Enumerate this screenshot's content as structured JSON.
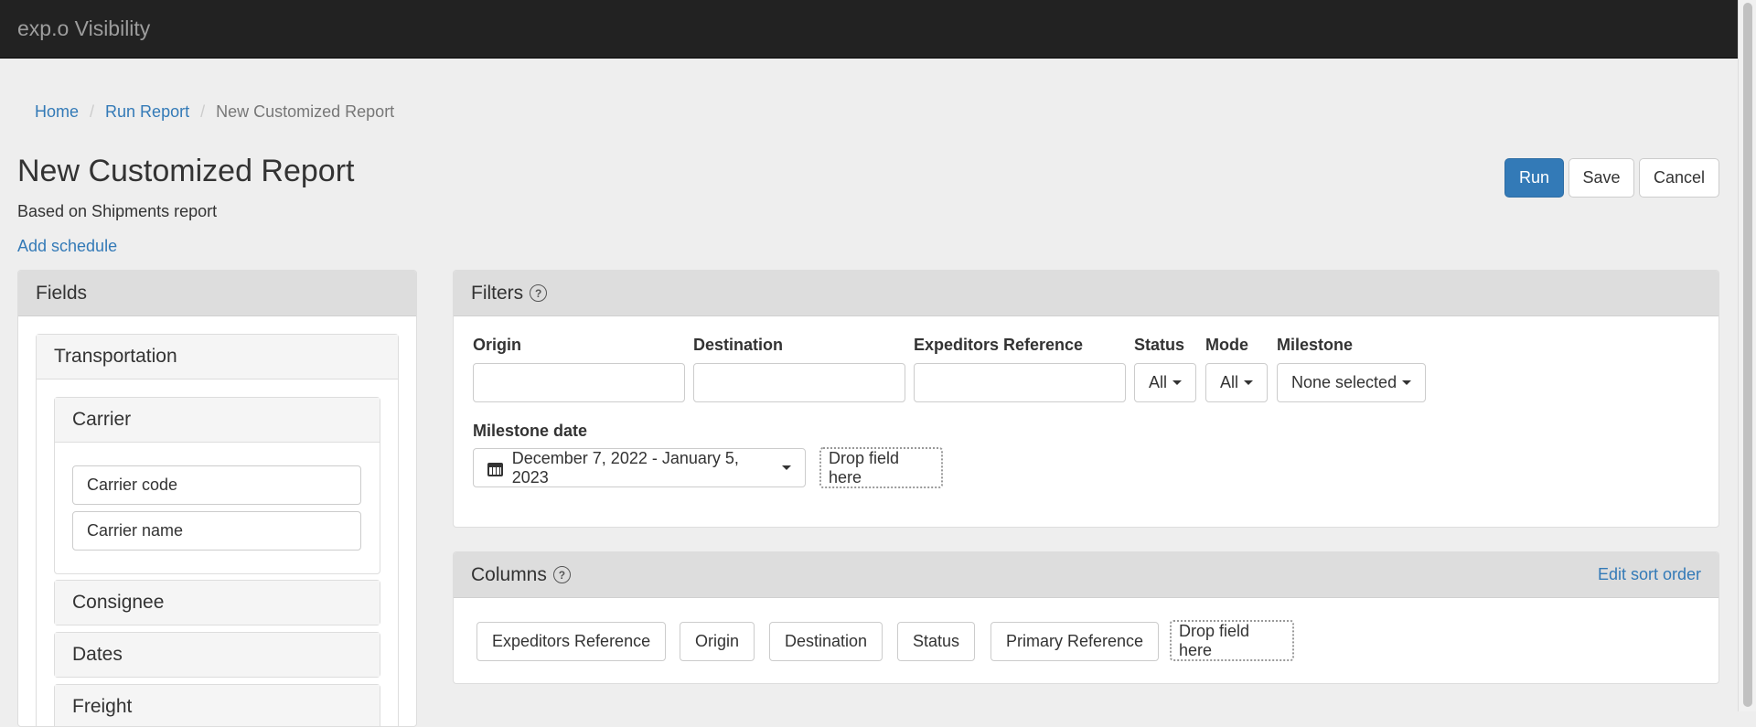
{
  "app": {
    "brand": "exp.o Visibility"
  },
  "breadcrumb": {
    "home": "Home",
    "run_report": "Run Report",
    "current": "New Customized Report"
  },
  "page": {
    "title": "New Customized Report",
    "subtitle": "Based on Shipments report",
    "add_schedule": "Add schedule"
  },
  "actions": {
    "run": "Run",
    "save": "Save",
    "cancel": "Cancel"
  },
  "fields": {
    "heading": "Fields",
    "group": "Transportation",
    "carrier": {
      "label": "Carrier",
      "items": [
        "Carrier code",
        "Carrier name"
      ]
    },
    "sections": [
      "Consignee",
      "Dates",
      "Freight"
    ]
  },
  "filters": {
    "heading": "Filters",
    "help": "?",
    "origin_label": "Origin",
    "origin_value": "",
    "destination_label": "Destination",
    "destination_value": "",
    "expeditors_ref_label": "Expeditors Reference",
    "expeditors_ref_value": "",
    "status_label": "Status",
    "status_value": "All",
    "mode_label": "Mode",
    "mode_value": "All",
    "milestone_label": "Milestone",
    "milestone_value": "None selected",
    "milestone_date_label": "Milestone date",
    "milestone_date_value": "December 7, 2022 - January 5, 2023",
    "drop_field": "Drop field here"
  },
  "columns": {
    "heading": "Columns",
    "help": "?",
    "edit_sort": "Edit sort order",
    "items": [
      "Expeditors Reference",
      "Origin",
      "Destination",
      "Status",
      "Primary Reference"
    ],
    "drop_field": "Drop field here"
  },
  "colors": {
    "navbar": "#222222",
    "link": "#337ab7",
    "primary": "#337ab7",
    "background": "#eeeeee"
  }
}
